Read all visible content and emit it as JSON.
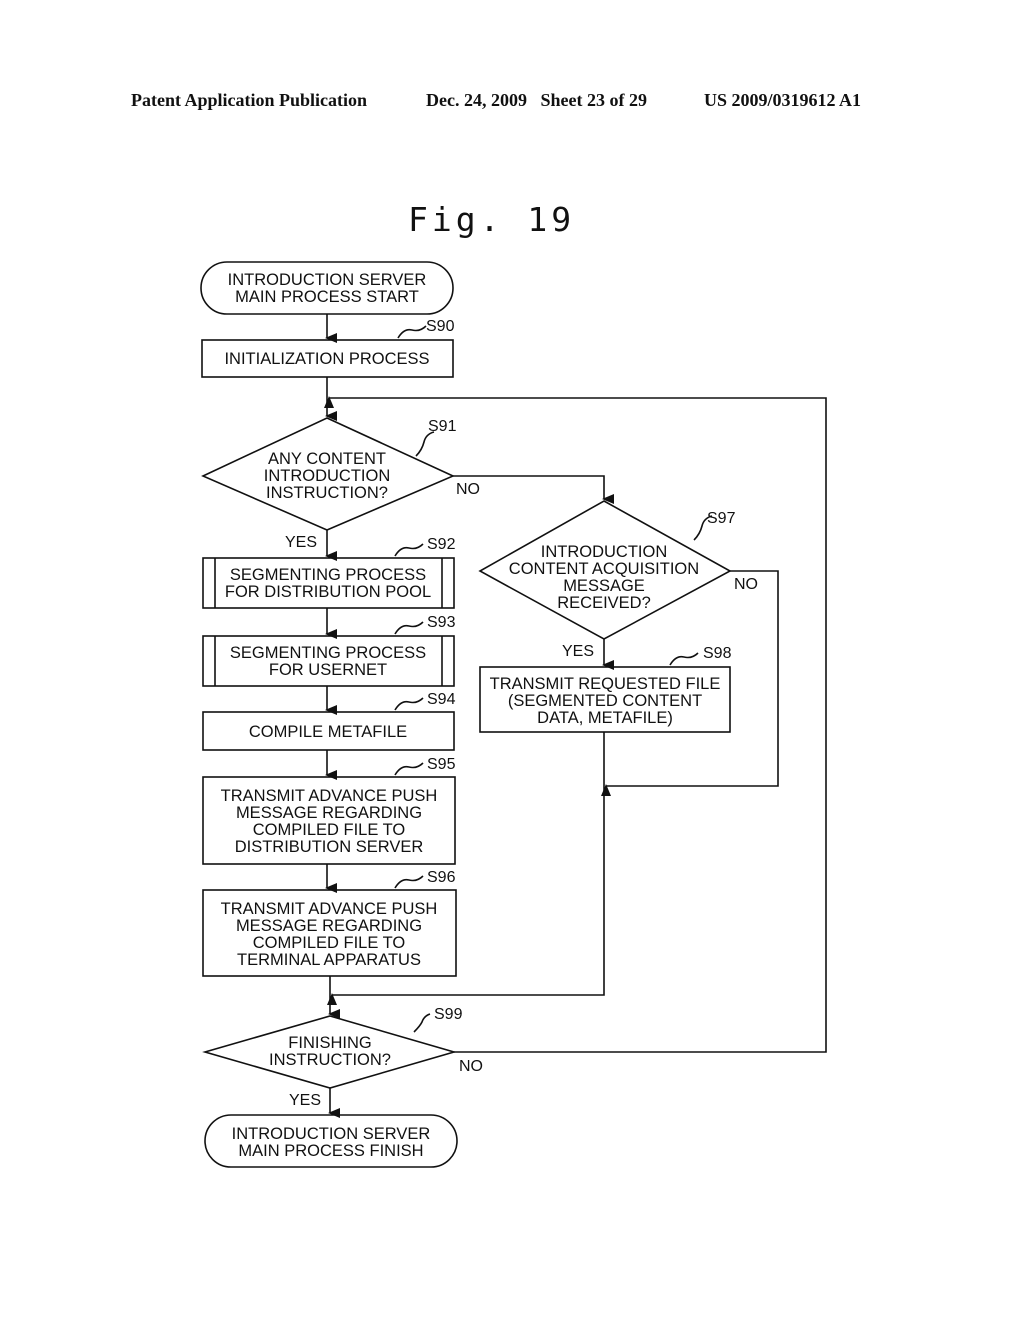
{
  "header": {
    "publication": "Patent Application Publication",
    "date_sheet": "Dec. 24, 2009   Sheet 23 of 29",
    "patent_number": "US 2009/0319612 A1"
  },
  "figure": {
    "title": "Fig. 19"
  },
  "flowchart": {
    "start": {
      "lines": [
        "INTRODUCTION SERVER",
        "MAIN PROCESS START"
      ]
    },
    "s90": {
      "step": "S90",
      "lines": [
        "INITIALIZATION PROCESS"
      ]
    },
    "s91": {
      "step": "S91",
      "lines": [
        "ANY CONTENT",
        "INTRODUCTION",
        "INSTRUCTION?"
      ],
      "yes": "YES",
      "no": "NO"
    },
    "s92": {
      "step": "S92",
      "lines": [
        "SEGMENTING PROCESS",
        "FOR DISTRIBUTION POOL"
      ]
    },
    "s93": {
      "step": "S93",
      "lines": [
        "SEGMENTING PROCESS",
        "FOR USERNET"
      ]
    },
    "s94": {
      "step": "S94",
      "lines": [
        "COMPILE METAFILE"
      ]
    },
    "s95": {
      "step": "S95",
      "lines": [
        "TRANSMIT ADVANCE PUSH",
        "MESSAGE REGARDING",
        "COMPILED FILE TO",
        "DISTRIBUTION SERVER"
      ]
    },
    "s96": {
      "step": "S96",
      "lines": [
        "TRANSMIT ADVANCE PUSH",
        "MESSAGE REGARDING",
        "COMPILED FILE TO",
        "TERMINAL APPARATUS"
      ]
    },
    "s97": {
      "step": "S97",
      "lines": [
        "INTRODUCTION",
        "CONTENT ACQUISITION",
        "MESSAGE",
        "RECEIVED?"
      ],
      "yes": "YES",
      "no": "NO"
    },
    "s98": {
      "step": "S98",
      "lines": [
        "TRANSMIT REQUESTED FILE",
        "(SEGMENTED CONTENT",
        "DATA, METAFILE)"
      ]
    },
    "s99": {
      "step": "S99",
      "lines": [
        "FINISHING",
        "INSTRUCTION?"
      ],
      "yes": "YES",
      "no": "NO"
    },
    "finish": {
      "lines": [
        "INTRODUCTION SERVER",
        "MAIN PROCESS FINISH"
      ]
    }
  }
}
